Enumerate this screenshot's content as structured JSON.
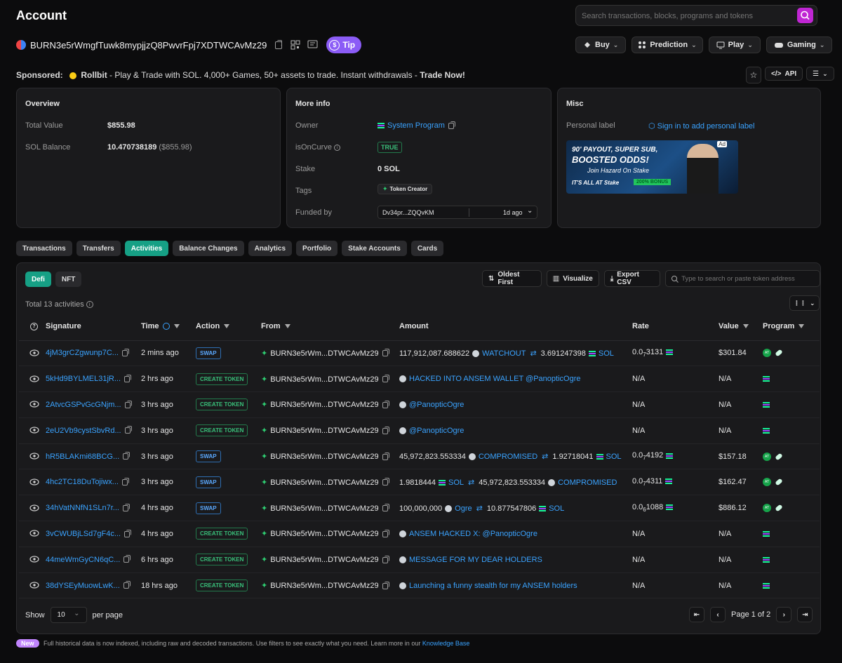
{
  "header": {
    "title": "Account",
    "search_placeholder": "Search transactions, blocks, programs and tokens",
    "address": "BURN3e5rWmgfTuwk8mypjjzQ8PwvrFpj7XDTWCAvMz29",
    "tip_label": "Tip",
    "nav": [
      {
        "label": "Buy",
        "icon": "buy-icon"
      },
      {
        "label": "Prediction",
        "icon": "prediction-icon"
      },
      {
        "label": "Play",
        "icon": "play-icon"
      },
      {
        "label": "Gaming",
        "icon": "gamepad-icon"
      }
    ]
  },
  "sponsor": {
    "label": "Sponsored:",
    "brand": "Rollbit",
    "text": " - Play & Trade with SOL. 4,000+ Games, 50+ assets to trade. Instant withdrawals - ",
    "cta": "Trade Now!",
    "api_label": "API"
  },
  "overview": {
    "title": "Overview",
    "total_value_label": "Total Value",
    "total_value": "$855.98",
    "sol_balance_label": "SOL Balance",
    "sol_balance": "10.470738189",
    "sol_balance_usd": "($855.98)"
  },
  "more_info": {
    "title": "More info",
    "owner_label": "Owner",
    "owner_value": "System Program",
    "oncurve_label": "isOnCurve",
    "oncurve_value": "TRUE",
    "stake_label": "Stake",
    "stake_value": "0 SOL",
    "tags_label": "Tags",
    "tag_value": "Token Creator",
    "funded_label": "Funded by",
    "funded_value": "Dv34pr...ZQQvKM",
    "funded_time": "1d ago"
  },
  "misc": {
    "title": "Misc",
    "personal_label": "Personal label",
    "sign_in": "Sign in to add personal label",
    "ad": {
      "badge": "Ad",
      "line1": "90' PAYOUT, SUPER SUB,",
      "line2": "BOOSTED ODDS!",
      "line3": "Join Hazard On Stake",
      "line4": "IT'S ALL AT Stake",
      "bonus": "200% BONUS"
    }
  },
  "tabs": [
    "Transactions",
    "Transfers",
    "Activities",
    "Balance Changes",
    "Analytics",
    "Portfolio",
    "Stake Accounts",
    "Cards"
  ],
  "active_tab": "Activities",
  "activities": {
    "subtabs": [
      "Defi",
      "NFT"
    ],
    "oldest_first": "Oldest First",
    "visualize": "Visualize",
    "export_csv": "Export CSV",
    "token_search_placeholder": "Type to search or paste token address",
    "total": "Total 13 activities",
    "columns": [
      "Signature",
      "Time",
      "Action",
      "From",
      "Amount",
      "Rate",
      "Value",
      "Program"
    ],
    "rows": [
      {
        "sig": "4jM3grCZgwunp7C...",
        "time": "2 mins ago",
        "action": "SWAP",
        "from": "BURN3e5rWm...DTWCAvMz29",
        "amt1": "117,912,087.688622",
        "tok1": "WATCHOUT",
        "amt2": "3.691247398",
        "tok2": "SOL",
        "rate_a": "0.0",
        "rate_sub": "7",
        "rate_b": "3131",
        "value": "$301.84",
        "prog": "swap"
      },
      {
        "sig": "5kHd9BYLMEL31jR...",
        "time": "2 hrs ago",
        "action": "CREATE TOKEN",
        "from": "BURN3e5rWm...DTWCAvMz29",
        "amt1": "",
        "tok1": "HACKED INTO ANSEM WALLET @PanopticOgre",
        "amt2": "",
        "tok2": "",
        "rate_a": "N/A",
        "rate_sub": "",
        "rate_b": "",
        "value": "N/A",
        "prog": "create"
      },
      {
        "sig": "2AtvcGSPvGcGNjm...",
        "time": "3 hrs ago",
        "action": "CREATE TOKEN",
        "from": "BURN3e5rWm...DTWCAvMz29",
        "amt1": "",
        "tok1": "@PanopticOgre",
        "amt2": "",
        "tok2": "",
        "rate_a": "N/A",
        "rate_sub": "",
        "rate_b": "",
        "value": "N/A",
        "prog": "create"
      },
      {
        "sig": "2eU2Vb9cystSbvRd...",
        "time": "3 hrs ago",
        "action": "CREATE TOKEN",
        "from": "BURN3e5rWm...DTWCAvMz29",
        "amt1": "",
        "tok1": "@PanopticOgre",
        "amt2": "",
        "tok2": "",
        "rate_a": "N/A",
        "rate_sub": "",
        "rate_b": "",
        "value": "N/A",
        "prog": "create"
      },
      {
        "sig": "hR5BLAKmi68BCG...",
        "time": "3 hrs ago",
        "action": "SWAP",
        "from": "BURN3e5rWm...DTWCAvMz29",
        "amt1": "45,972,823.553334",
        "tok1": "COMPROMISED",
        "amt2": "1.92718041",
        "tok2": "SOL",
        "rate_a": "0.0",
        "rate_sub": "7",
        "rate_b": "4192",
        "value": "$157.18",
        "prog": "swap"
      },
      {
        "sig": "4hc2TC18DuTojiwx...",
        "time": "3 hrs ago",
        "action": "SWAP",
        "from": "BURN3e5rWm...DTWCAvMz29",
        "amt1": "1.9818444",
        "tok1": "SOL",
        "amt2": "45,972,823.553334",
        "tok2": "COMPROMISED",
        "rate_a": "0.0",
        "rate_sub": "7",
        "rate_b": "4311",
        "value": "$162.47",
        "prog": "swap"
      },
      {
        "sig": "34hVatNNfN1SLn7r...",
        "time": "4 hrs ago",
        "action": "SWAP",
        "from": "BURN3e5rWm...DTWCAvMz29",
        "amt1": "100,000,000",
        "tok1": "Ogre",
        "amt2": "10.877547806",
        "tok2": "SOL",
        "rate_a": "0.0",
        "rate_sub": "6",
        "rate_b": "1088",
        "value": "$886.12",
        "prog": "swap"
      },
      {
        "sig": "3vCWUBjLSd7gF4c...",
        "time": "4 hrs ago",
        "action": "CREATE TOKEN",
        "from": "BURN3e5rWm...DTWCAvMz29",
        "amt1": "",
        "tok1": "ANSEM HACKED X: @PanopticOgre",
        "amt2": "",
        "tok2": "",
        "rate_a": "N/A",
        "rate_sub": "",
        "rate_b": "",
        "value": "N/A",
        "prog": "create"
      },
      {
        "sig": "44meWmGyCN6qC...",
        "time": "6 hrs ago",
        "action": "CREATE TOKEN",
        "from": "BURN3e5rWm...DTWCAvMz29",
        "amt1": "",
        "tok1": "MESSAGE FOR MY DEAR HOLDERS",
        "amt2": "",
        "tok2": "",
        "rate_a": "N/A",
        "rate_sub": "",
        "rate_b": "",
        "value": "N/A",
        "prog": "create"
      },
      {
        "sig": "38dYSEyMuowLwK...",
        "time": "18 hrs ago",
        "action": "CREATE TOKEN",
        "from": "BURN3e5rWm...DTWCAvMz29",
        "amt1": "",
        "tok1": "Launching a funny stealth for my ANSEM holders",
        "amt2": "",
        "tok2": "",
        "rate_a": "N/A",
        "rate_sub": "",
        "rate_b": "",
        "value": "N/A",
        "prog": "create"
      }
    ],
    "show_label": "Show",
    "per_page_value": "10",
    "per_page_label": "per page",
    "page_text": "Page 1 of 2"
  },
  "footer": {
    "new_badge": "New",
    "text": "Full historical data is now indexed, including raw and decoded transactions. Use filters to see exactly what you need. Learn more in our ",
    "link": "Knowledge Base"
  },
  "colors": {
    "accent": "#16a085",
    "link": "#3aa3ff",
    "tip": "#8b5cf6",
    "search_button": "#c026d3"
  }
}
